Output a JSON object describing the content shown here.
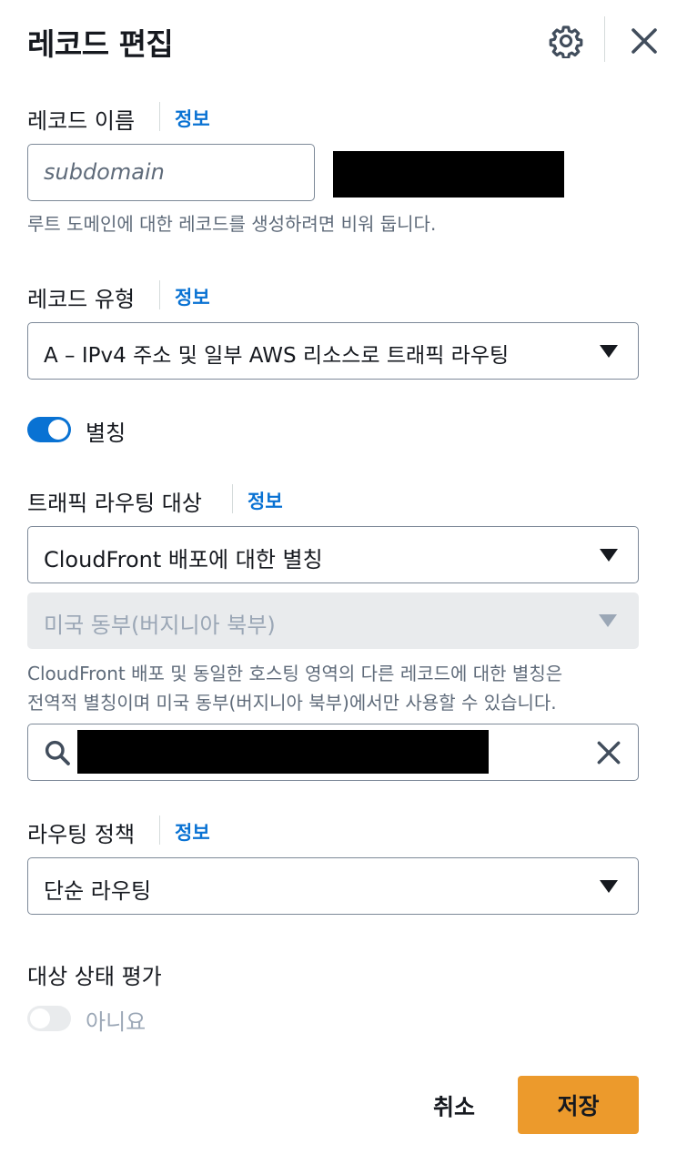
{
  "header": {
    "title": "레코드 편집"
  },
  "record_name": {
    "label": "레코드 이름",
    "info": "정보",
    "placeholder": "subdomain",
    "hint": "루트 도메인에 대한 레코드를 생성하려면 비워 둡니다."
  },
  "record_type": {
    "label": "레코드 유형",
    "info": "정보",
    "value": "A – IPv4 주소 및 일부 AWS 리소스로 트래픽 라우팅"
  },
  "alias": {
    "label": "별칭",
    "enabled": true
  },
  "route_target": {
    "label": "트래픽 라우팅 대상",
    "info": "정보",
    "value": "CloudFront 배포에 대한 별칭",
    "region": "미국 동부(버지니아 북부)",
    "hint_line1": "CloudFront 배포 및 동일한 호스팅 영역의 다른 레코드에 대한 별칭은",
    "hint_line2": "전역적 별칭이며 미국 동부(버지니아 북부)에서만 사용할 수 있습니다."
  },
  "routing_policy": {
    "label": "라우팅 정책",
    "info": "정보",
    "value": "단순 라우팅"
  },
  "health": {
    "label": "대상 상태 평가",
    "toggle_label": "아니요",
    "enabled": false
  },
  "footer": {
    "cancel": "취소",
    "save": "저장"
  },
  "colors": {
    "accent": "#0972d3",
    "primary_button": "#ec9a2c"
  },
  "icons": [
    "gear-icon",
    "close-icon",
    "caret-down-icon",
    "search-icon",
    "clear-icon"
  ]
}
